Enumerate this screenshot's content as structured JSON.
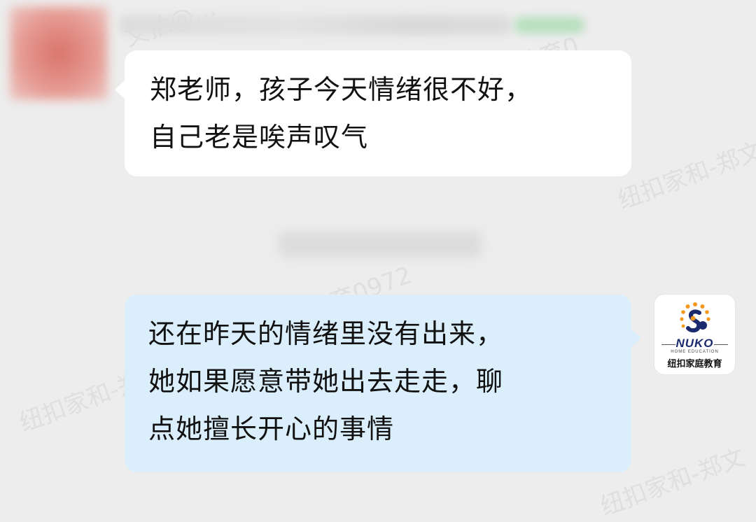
{
  "chat": {
    "messages": [
      {
        "sender": "contact",
        "lines": [
          "郑老师，孩子今天情绪很不好，",
          "自己老是唉声叹气"
        ]
      },
      {
        "sender": "self",
        "lines": [
          "还在昨天的情绪里没有出来，",
          "她如果愿意带她出去走走，聊",
          "点她擅长开心的事情"
        ]
      }
    ]
  },
  "avatar_self": {
    "brand": "NUKO",
    "sub": "HOME EDUCATION",
    "name_cn": "纽扣家庭教育",
    "icon": "nuko-logo-icon"
  },
  "watermarks": [
    {
      "text": "纽扣家和-郑文"
    },
    {
      "text": "纽扣家和-郑文"
    },
    {
      "text": "庭教育0972"
    },
    {
      "text": "纽扣家和-郑文"
    },
    {
      "text": "文抽@…"
    },
    {
      "text": "庭教育0"
    }
  ],
  "colors": {
    "background": "#ededed",
    "bubble_contact": "#ffffff",
    "bubble_self": "#dbeefc",
    "logo_orange": "#f39a1e",
    "logo_navy": "#1a2a6c"
  }
}
